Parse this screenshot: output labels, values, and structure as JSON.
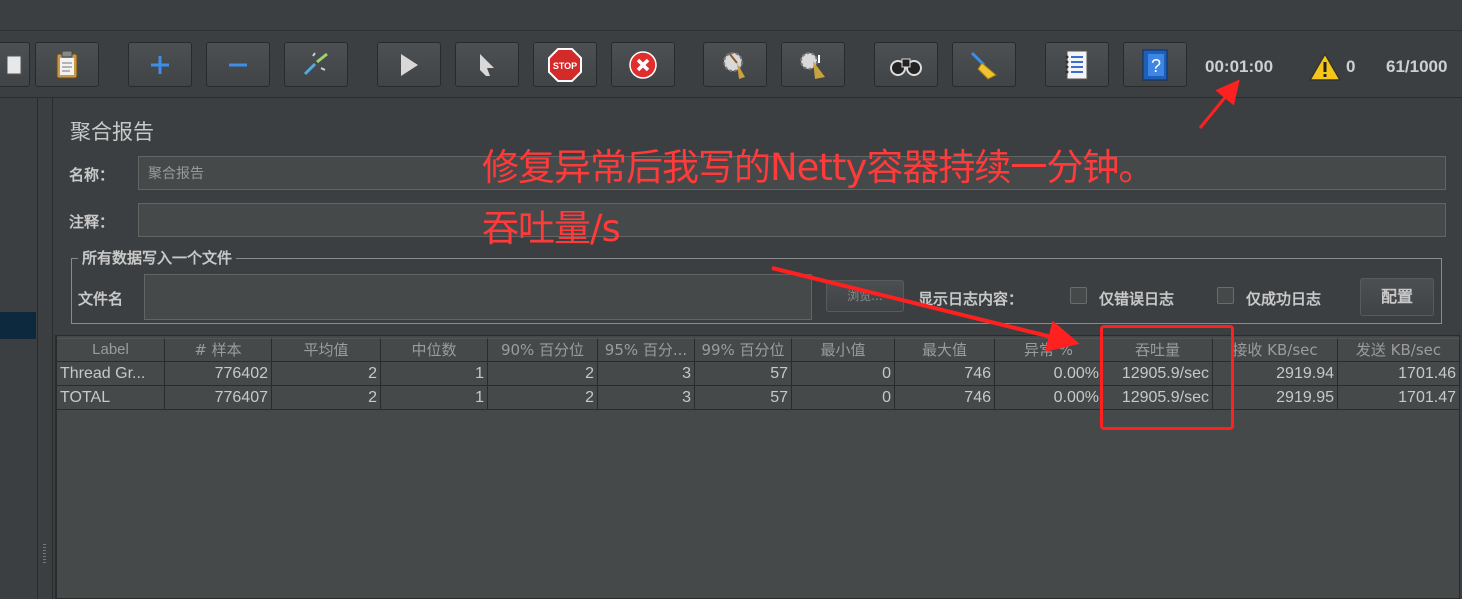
{
  "toolbar": {
    "buttons": [
      {
        "id": "clipboard",
        "icon": "clipboard-icon"
      },
      {
        "id": "expand",
        "icon": "plus-icon",
        "glyph": "+"
      },
      {
        "id": "collapse",
        "icon": "minus-icon",
        "glyph": "−"
      },
      {
        "id": "toggle",
        "icon": "toggle-wand-icon"
      },
      {
        "id": "start",
        "icon": "play-icon"
      },
      {
        "id": "start-no-pause",
        "icon": "play-no-pause-icon"
      },
      {
        "id": "stop",
        "icon": "stop-sign-icon",
        "label": "STOP"
      },
      {
        "id": "shutdown",
        "icon": "shutdown-x-icon"
      },
      {
        "id": "clear",
        "icon": "clear-broom-gear-icon"
      },
      {
        "id": "clear-all",
        "icon": "clear-all-broom-gear-icon"
      },
      {
        "id": "search",
        "icon": "binoculars-icon"
      },
      {
        "id": "reset-search",
        "icon": "broom-icon"
      },
      {
        "id": "function-helper",
        "icon": "function-list-icon"
      },
      {
        "id": "help",
        "icon": "help-book-icon",
        "glyph": "?"
      }
    ],
    "elapsed_time": "00:01:00",
    "warning_count": "0",
    "threads": "61/1000"
  },
  "panel": {
    "title": "聚合报告",
    "name_label": "名称：",
    "name_value": "聚合报告",
    "comment_label": "注释：",
    "comment_value": "",
    "file_group_legend": "所有数据写入一个文件",
    "filename_label": "文件名",
    "filename_value": "",
    "browse_button": "浏览...",
    "log_content_label": "显示日志内容：",
    "errors_only_label": "仅错误日志",
    "success_only_label": "仅成功日志",
    "configure_button": "配置"
  },
  "table": {
    "headers": [
      "Label",
      "# 样本",
      "平均值",
      "中位数",
      "90% 百分位",
      "95% 百分...",
      "99% 百分位",
      "最小值",
      "最大值",
      "异常 %",
      "吞吐量",
      "接收 KB/sec",
      "发送 KB/sec"
    ],
    "rows": [
      [
        "Thread Gr...",
        "776402",
        "2",
        "1",
        "2",
        "3",
        "57",
        "0",
        "746",
        "0.00%",
        "12905.9/sec",
        "2919.94",
        "1701.46"
      ],
      [
        "TOTAL",
        "776407",
        "2",
        "1",
        "2",
        "3",
        "57",
        "0",
        "746",
        "0.00%",
        "12905.9/sec",
        "2919.95",
        "1701.47"
      ]
    ]
  },
  "annotation": {
    "line1": "修复异常后我写的Netty容器持续一分钟。",
    "line2": "吞吐量/s",
    "color": "#ff3a3a"
  }
}
